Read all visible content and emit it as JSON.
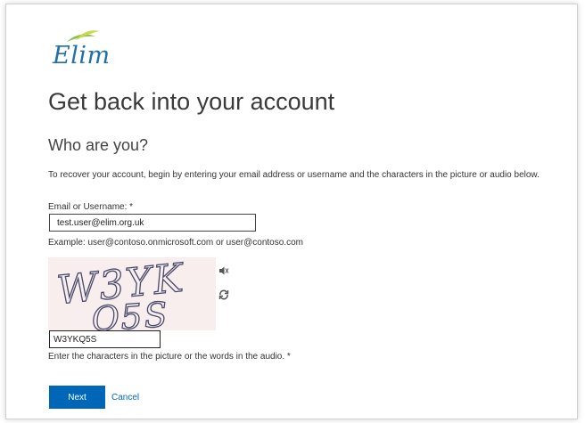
{
  "brand": {
    "logo_text": "Elim",
    "logo_color": "#1f6fa8",
    "leaf_color": "#8bc34a"
  },
  "page": {
    "title": "Get back into your account",
    "subtitle": "Who are you?",
    "intro": "To recover your account, begin by entering your email address or username and the characters in the picture or audio below."
  },
  "email": {
    "label": "Email or Username: *",
    "value": "test.user@elim.org.uk",
    "example": "Example: user@contoso.onmicrosoft.com or user@contoso.com"
  },
  "captcha": {
    "line1": "W3YK",
    "line2": "Q5S",
    "input_value": "W3YKQ5S",
    "help": "Enter the characters in the picture or the words in the audio. *",
    "audio_icon": "speaker-icon",
    "refresh_icon": "refresh-icon"
  },
  "actions": {
    "next_label": "Next",
    "cancel_label": "Cancel",
    "accent": "#0067b8"
  }
}
